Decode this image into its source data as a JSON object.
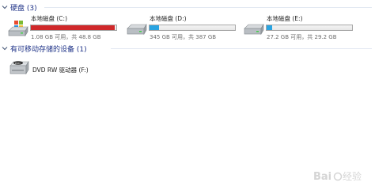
{
  "hard_disks": {
    "header": "硬盘 (3)",
    "drives": [
      {
        "name": "本地磁盘 (C:)",
        "info": "1.08 GB 可用，共 48.8 GB",
        "used_fraction": 0.978,
        "bar_color": "#d0282a"
      },
      {
        "name": "本地磁盘 (D:)",
        "info": "345 GB 可用，共 387 GB",
        "used_fraction": 0.109,
        "bar_color": "#29a4e2"
      },
      {
        "name": "本地磁盘 (E:)",
        "info": "27.2 GB 可用，共 29.2 GB",
        "used_fraction": 0.068,
        "bar_color": "#29a4e2"
      }
    ]
  },
  "removable": {
    "header": "有可移动存储的设备 (1)",
    "drives": [
      {
        "name": "DVD RW 驱动器 (F:)"
      }
    ]
  },
  "colors": {
    "group_header": "#1e3287",
    "bar_warning": "#d0282a",
    "bar_normal": "#29a4e2"
  },
  "watermark": {
    "text": "Baidu 经验"
  }
}
